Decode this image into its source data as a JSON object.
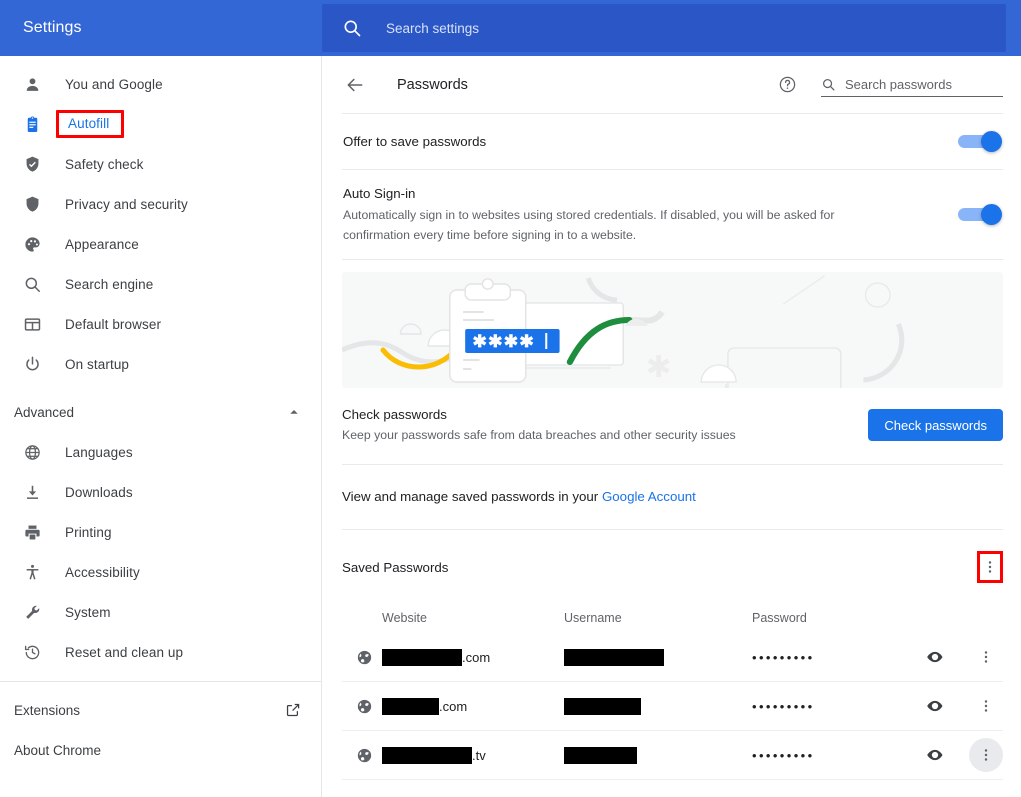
{
  "topbar": {
    "title": "Settings",
    "search_icon": "search-icon",
    "search_placeholder": "Search settings"
  },
  "sidebar": {
    "items": [
      {
        "label": "You and Google",
        "icon": "person-icon",
        "selected": false
      },
      {
        "label": "Autofill",
        "icon": "clipboard-icon",
        "selected": true
      },
      {
        "label": "Safety check",
        "icon": "shield-check-icon",
        "selected": false
      },
      {
        "label": "Privacy and security",
        "icon": "shield-icon",
        "selected": false
      },
      {
        "label": "Appearance",
        "icon": "palette-icon",
        "selected": false
      },
      {
        "label": "Search engine",
        "icon": "search-icon",
        "selected": false
      },
      {
        "label": "Default browser",
        "icon": "browser-window-icon",
        "selected": false
      },
      {
        "label": "On startup",
        "icon": "power-icon",
        "selected": false
      }
    ],
    "advanced": {
      "label": "Advanced",
      "icon": "chevron-up-icon"
    },
    "advanced_items": [
      {
        "label": "Languages",
        "icon": "globe-icon"
      },
      {
        "label": "Downloads",
        "icon": "download-icon"
      },
      {
        "label": "Printing",
        "icon": "printer-icon"
      },
      {
        "label": "Accessibility",
        "icon": "accessibility-icon"
      },
      {
        "label": "System",
        "icon": "wrench-icon"
      },
      {
        "label": "Reset and clean up",
        "icon": "history-restore-icon"
      }
    ],
    "footer": [
      {
        "label": "Extensions",
        "icon": "external-link-icon",
        "has_icon": true
      },
      {
        "label": "About Chrome",
        "icon": "",
        "has_icon": false
      }
    ]
  },
  "page": {
    "back_icon": "arrow-left-icon",
    "title": "Passwords",
    "help_icon": "help-circle-icon",
    "search_icon": "search-icon",
    "search_placeholder": "Search passwords"
  },
  "settings": {
    "offer_to_save": {
      "title": "Offer to save passwords",
      "toggle_on": true
    },
    "auto_signin": {
      "title": "Auto Sign-in",
      "description": "Automatically sign in to websites using stored credentials. If disabled, you will be asked for confirmation every time before signing in to a website.",
      "toggle_on": true
    }
  },
  "banner": {
    "password_field_text": "✱✱✱✱",
    "illustration": "passwords-illustration"
  },
  "check_passwords": {
    "title": "Check passwords",
    "description": "Keep your passwords safe from data breaches and other security issues",
    "button_label": "Check passwords"
  },
  "manage": {
    "prefix": "View and manage saved passwords in your ",
    "link_label": "Google Account"
  },
  "saved_passwords": {
    "heading": "Saved Passwords",
    "menu_icon": "more-vert-icon",
    "columns": [
      "Website",
      "Username",
      "Password"
    ],
    "rows": [
      {
        "favicon": "globe-icon",
        "website_redacted_width": 80,
        "website_suffix": ".com",
        "username_redacted_width": 100,
        "password_masked": "•••••••••",
        "show_icon": "eye-icon",
        "menu_icon": "more-vert-icon",
        "menu_active": false
      },
      {
        "favicon": "globe-icon",
        "website_redacted_width": 57,
        "website_suffix": ".com",
        "username_redacted_width": 77,
        "password_masked": "•••••••••",
        "show_icon": "eye-icon",
        "menu_icon": "more-vert-icon",
        "menu_active": false
      },
      {
        "favicon": "globe-icon",
        "website_redacted_width": 90,
        "website_suffix": ".tv",
        "username_redacted_width": 73,
        "password_masked": "•••••••••",
        "show_icon": "eye-icon",
        "menu_icon": "more-vert-icon",
        "menu_active": true
      }
    ]
  },
  "colors": {
    "topbar_blue": "#3367d6",
    "searchbox_blue": "#2a56c6",
    "accent_blue": "#1a73e8",
    "link_blue": "#1a73e8",
    "toggle_track": "#8ab4f8",
    "highlight_red": "#ff0000",
    "banner_bg": "#f7f8f8",
    "text_primary": "#202124",
    "text_secondary": "#5f6368"
  }
}
